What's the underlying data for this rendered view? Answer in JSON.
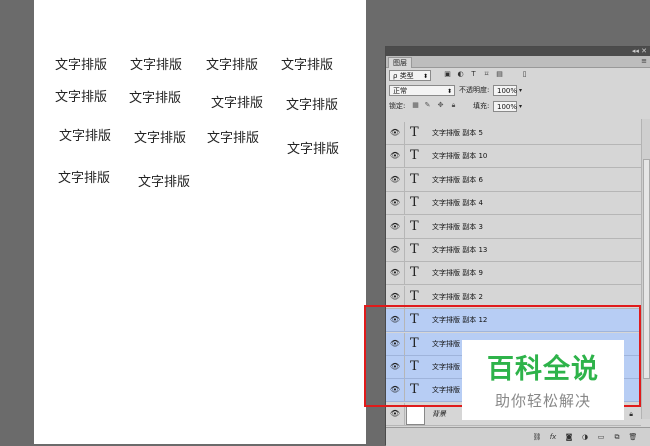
{
  "canvas": {
    "texts": [
      "文字排版",
      "文字排版",
      "文字排版",
      "文字排版",
      "文字排版",
      "文字排版",
      "文字排版",
      "文字排版",
      "文字排版",
      "文字排版",
      "文字排版",
      "文字排版",
      "文字排版",
      "文字排版"
    ]
  },
  "panel": {
    "tab_label": "图层",
    "filter_kind": "类型",
    "blend_mode": "正常",
    "opacity_label": "不透明度:",
    "opacity_value": "100%",
    "lock_label": "锁定:",
    "fill_label": "填充:",
    "fill_value": "100%"
  },
  "layers": [
    {
      "name": "文字排版 副本 5",
      "selected": false
    },
    {
      "name": "文字排版 副本 10",
      "selected": false
    },
    {
      "name": "文字排版 副本 6",
      "selected": false
    },
    {
      "name": "文字排版 副本 4",
      "selected": false
    },
    {
      "name": "文字排版 副本 3",
      "selected": false
    },
    {
      "name": "文字排版 副本 13",
      "selected": false
    },
    {
      "name": "文字排版 副本 9",
      "selected": false
    },
    {
      "name": "文字排版 副本 2",
      "selected": false
    },
    {
      "name": "文字排版 副本 12",
      "selected": true
    },
    {
      "name": "文字排版",
      "selected": true
    },
    {
      "name": "文字排版",
      "selected": true
    },
    {
      "name": "文字排版",
      "selected": true
    }
  ],
  "background_layer": {
    "name": "背景"
  },
  "layer_glyph": "T",
  "watermark": {
    "title": "百科全说",
    "subtitle": "助你轻松解决"
  },
  "colors": {
    "selected_row": "#b7cdf4",
    "highlight": "#e01b1b",
    "watermark_green": "#2eb34a"
  }
}
